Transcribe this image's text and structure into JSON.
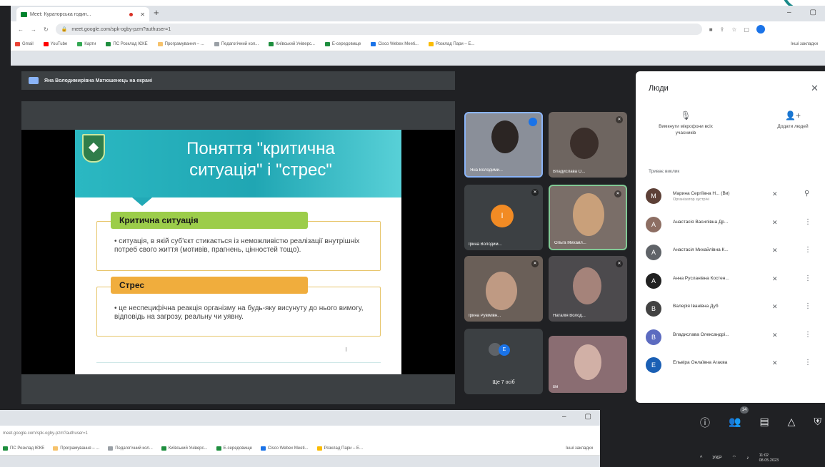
{
  "browser": {
    "tab_title": "Meet: Кураторська годин...",
    "new_tab": "+",
    "min": "–",
    "max": "▢",
    "url": "meet.google.com/spk-ogby-pzm?authuser=1",
    "bookmarks": [
      {
        "label": "Gmail",
        "color": "#ea4335"
      },
      {
        "label": "YouTube",
        "color": "#ff0000"
      },
      {
        "label": "Карти",
        "color": "#34a853"
      },
      {
        "label": "ПС Розклад ІЄКЕ",
        "color": "#1e8e3e"
      },
      {
        "label": "Програмування – ...",
        "color": "#f6c26b"
      },
      {
        "label": "Педагогічний кол...",
        "color": "#9aa0a6"
      },
      {
        "label": "Київський Універс...",
        "color": "#1e8e3e"
      },
      {
        "label": "Е-середовище",
        "color": "#1e8e3e"
      },
      {
        "label": "Cisco Webex Meeti...",
        "color": "#1a73e8"
      },
      {
        "label": "Розклад Пари – Е...",
        "color": "#fbbc04"
      }
    ],
    "bookmarks_other": "Інші закладки"
  },
  "meet": {
    "presenter_header": "Яна Володимирівна Матюшенець на екрані"
  },
  "slide": {
    "title_line1": "Поняття \"критична",
    "title_line2": "ситуація\" і \"стрес\"",
    "box1_label": "Критична ситуація",
    "box1_text": "• ситуація, в якій суб'єкт стикається із неможливістю реалізації внутрішніх потреб свого життя (мотивів, прагнень, цінностей тощо).",
    "box2_label": "Стрес",
    "box2_text": "• це неспецифічна реакція організму на будь-яку висунуту до нього вимогу, відповідь на загрозу, реальну чи уявну."
  },
  "tiles": [
    {
      "name": "Яна Володими...",
      "id": "t1"
    },
    {
      "name": "Владислава О...",
      "id": "t2"
    },
    {
      "name": "Ірина Володим...",
      "id": "t3",
      "initial": "І"
    },
    {
      "name": "Ольга Михайл...",
      "id": "t4"
    },
    {
      "name": "Ірина Рувімівн...",
      "id": "t5"
    },
    {
      "name": "Наталія Волод...",
      "id": "t6"
    },
    {
      "name": "Ще 7 осіб",
      "id": "t7"
    },
    {
      "name": "Ви",
      "id": "t8"
    }
  ],
  "people": {
    "title": "Люди",
    "close": "✕",
    "mute_all": "Вимкнути мікрофони всіх учасників",
    "add_people": "Додати людей",
    "section": "Триває виклик",
    "list": [
      {
        "name": "Марина Сергіївна Н... (Ви)",
        "role": "Організатор зустрічі",
        "initial": "М",
        "color": "#5d4037"
      },
      {
        "name": "Анастасія Василівна Др...",
        "role": "",
        "initial": "А",
        "color": "#8d6e63"
      },
      {
        "name": "Анастасія Михайлівна К...",
        "role": "",
        "initial": "А",
        "color": "#5f6368"
      },
      {
        "name": "Анна Русланівна Костен...",
        "role": "",
        "initial": "А",
        "color": "#212121"
      },
      {
        "name": "Валерія Іванівна Дуб",
        "role": "",
        "initial": "В",
        "color": "#424242"
      },
      {
        "name": "Владислава Олександрі...",
        "role": "",
        "initial": "В",
        "color": "#5c6bc0"
      },
      {
        "name": "Ельвіра Онлаївна Агаєва",
        "role": "",
        "initial": "Е",
        "color": "#1a5fb4"
      }
    ]
  },
  "controls": {
    "participants_count": "14"
  },
  "taskbar": {
    "lang": "УКР",
    "time": "11:02",
    "date": "08.05.2023"
  }
}
